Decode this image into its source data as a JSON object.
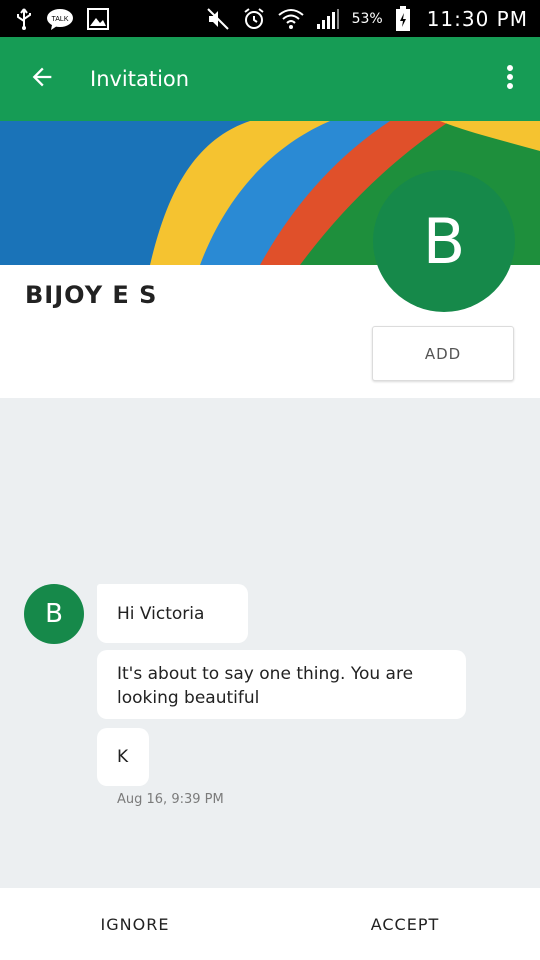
{
  "status_bar": {
    "battery_percent": "53%",
    "time": "11:30 PM",
    "icons": [
      "usb-icon",
      "talk-icon",
      "image-icon",
      "mute-icon",
      "alarm-icon",
      "wifi-icon",
      "signal-icon",
      "battery-icon"
    ]
  },
  "toolbar": {
    "title": "Invitation",
    "back_icon": "arrow-back-icon",
    "menu_icon": "more-vert-icon"
  },
  "profile": {
    "name": "BIJOY E S",
    "avatar_letter": "B",
    "add_label": "ADD",
    "avatar_color": "#16894a"
  },
  "messages": {
    "avatar_letter": "B",
    "items": [
      {
        "text": "Hi Victoria"
      },
      {
        "text": "It's about to say one thing. You are looking beautiful"
      },
      {
        "text": "K"
      }
    ],
    "timestamp": "Aug 16, 9:39 PM"
  },
  "actions": {
    "ignore_label": "IGNORE",
    "accept_label": "ACCEPT"
  },
  "colors": {
    "accent": "#169c55",
    "background": "#eceff1"
  }
}
